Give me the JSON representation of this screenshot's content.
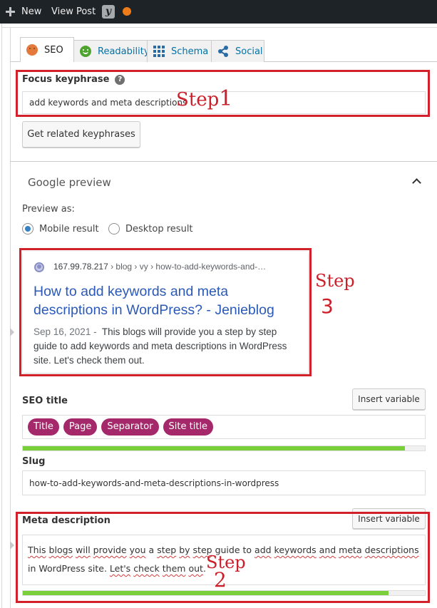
{
  "adminbar": {
    "new_label": "New",
    "view_post_label": "View Post",
    "yoast_glyph": "y",
    "seo_score_color": "#ee7c1b"
  },
  "tabs": [
    {
      "label": "SEO",
      "icon": "sad-face-orange-icon",
      "active": true
    },
    {
      "label": "Readability",
      "icon": "smiley-green-icon",
      "active": false
    },
    {
      "label": "Schema",
      "icon": "grid-icon",
      "active": false
    },
    {
      "label": "Social",
      "icon": "share-icon",
      "active": false
    }
  ],
  "focus_keyphrase": {
    "label": "Focus keyphrase",
    "help_glyph": "?",
    "value": "add keywords and meta descriptions",
    "related_button": "Get related keyphrases"
  },
  "google_preview": {
    "title": "Google preview",
    "preview_as_label": "Preview as:",
    "options": [
      {
        "label": "Mobile result",
        "checked": true
      },
      {
        "label": "Desktop result",
        "checked": false
      }
    ],
    "snippet": {
      "domain": "167.99.78.217",
      "path": " › blog › vy › how-to-add-keywords-and-…",
      "title": "How to add keywords and meta descriptions in WordPress? - Jenieblog",
      "date": "Sep 16, 2021",
      "separator": " - ",
      "description": "This blogs will provide you a step by step guide to add keywords and meta descriptions in WordPress site. Let's check them out."
    }
  },
  "seo_title": {
    "label": "SEO title",
    "insert_variable": "Insert variable",
    "variables": [
      "Title",
      "Page",
      "Separator",
      "Site title"
    ],
    "progress_percent": 95
  },
  "slug": {
    "label": "Slug",
    "value": "how-to-add-keywords-and-meta-descriptions-in-wordpress"
  },
  "meta_description": {
    "label": "Meta description",
    "insert_variable": "Insert variable",
    "value_parts": [
      {
        "t": "This",
        "sp": true
      },
      {
        "t": " "
      },
      {
        "t": "blogs",
        "sp": true
      },
      {
        "t": " "
      },
      {
        "t": "will",
        "sp": true
      },
      {
        "t": " "
      },
      {
        "t": "provide",
        "sp": true
      },
      {
        "t": " "
      },
      {
        "t": "you",
        "sp": true
      },
      {
        "t": " a "
      },
      {
        "t": "step",
        "sp": true
      },
      {
        "t": " "
      },
      {
        "t": "by",
        "sp": true
      },
      {
        "t": " "
      },
      {
        "t": "step",
        "sp": true
      },
      {
        "t": " guide to "
      },
      {
        "t": "add",
        "sp": true
      },
      {
        "t": " "
      },
      {
        "t": "keywords",
        "sp": true
      },
      {
        "t": " "
      },
      {
        "t": "and",
        "sp": true
      },
      {
        "t": " "
      },
      {
        "t": "meta",
        "sp": true
      },
      {
        "t": " "
      },
      {
        "t": "descriptions",
        "sp": true
      },
      {
        "t": " in WordPress site. "
      },
      {
        "t": "Let's",
        "sp": true
      },
      {
        "t": " "
      },
      {
        "t": "check",
        "sp": true
      },
      {
        "t": " "
      },
      {
        "t": "them",
        "sp": true
      },
      {
        "t": " "
      },
      {
        "t": "out",
        "sp": true
      },
      {
        "t": "."
      }
    ],
    "progress_percent": 91
  },
  "annotations": {
    "step1": "Step 1",
    "step1_word": "Step",
    "step1_num": "1",
    "step2_word": "Step",
    "step2_num": "2",
    "step3_word": "Step",
    "step3_num": "3",
    "color": "#d3212c"
  }
}
